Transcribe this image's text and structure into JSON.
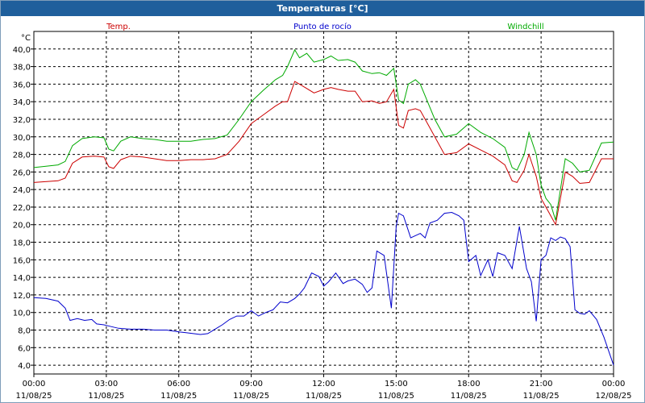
{
  "window": {
    "title": "Temperaturas [°C]"
  },
  "chart_data": {
    "type": "line",
    "title": "Temperaturas [°C]",
    "unit_label": "°C",
    "ylim": [
      3,
      42
    ],
    "ytick_values": [
      4,
      6,
      8,
      10,
      12,
      14,
      16,
      18,
      20,
      22,
      24,
      26,
      28,
      30,
      32,
      34,
      36,
      38,
      40
    ],
    "ytick_labels": [
      "4,0",
      "6,0",
      "8,0",
      "10,0",
      "12,0",
      "14,0",
      "16,0",
      "18,0",
      "20,0",
      "22,0",
      "24,0",
      "26,0",
      "28,0",
      "30,0",
      "32,0",
      "34,0",
      "36,0",
      "38,0",
      "40,0"
    ],
    "xlim": [
      0,
      24
    ],
    "xtick_values": [
      0,
      3,
      6,
      9,
      12,
      15,
      18,
      21,
      24
    ],
    "xtick_time": [
      "00:00",
      "03:00",
      "06:00",
      "09:00",
      "12:00",
      "15:00",
      "18:00",
      "21:00",
      "00:00"
    ],
    "xtick_date": [
      "11/08/25",
      "11/08/25",
      "11/08/25",
      "11/08/25",
      "11/08/25",
      "11/08/25",
      "11/08/25",
      "11/08/25",
      "12/08/25"
    ],
    "grid": true,
    "legend_placement": "top",
    "series": [
      {
        "name": "Temp.",
        "color": "#cc0000",
        "x": [
          0,
          1,
          1.3,
          1.6,
          2,
          2.5,
          2.9,
          3.1,
          3.3,
          3.6,
          4,
          4.5,
          5,
          5.5,
          6,
          6.5,
          7,
          7.5,
          8,
          8.5,
          9,
          9.5,
          10,
          10.3,
          10.5,
          10.8,
          11,
          11.3,
          11.6,
          12,
          12.3,
          12.6,
          13,
          13.3,
          13.6,
          14,
          14.3,
          14.6,
          14.9,
          15.1,
          15.3,
          15.5,
          15.8,
          16,
          16.3,
          16.6,
          17,
          17.5,
          18,
          18.5,
          19,
          19.5,
          19.8,
          20,
          20.3,
          20.5,
          20.8,
          21,
          21.2,
          21.4,
          21.6,
          22,
          22.3,
          22.6,
          23,
          23.5,
          24
        ],
        "y": [
          24.8,
          25,
          25.3,
          27,
          27.7,
          27.8,
          27.7,
          26.6,
          26.4,
          27.4,
          27.8,
          27.7,
          27.5,
          27.3,
          27.3,
          27.4,
          27.4,
          27.5,
          28,
          29.5,
          31.5,
          32.5,
          33.5,
          34,
          34,
          36.3,
          36,
          35.5,
          35,
          35.4,
          35.6,
          35.4,
          35.2,
          35.2,
          34,
          34.1,
          33.8,
          34,
          35.4,
          31.3,
          31,
          33,
          33.2,
          33,
          31.5,
          30,
          28,
          28.2,
          29.2,
          28.5,
          27.8,
          26.8,
          25,
          24.8,
          26.2,
          28,
          25.5,
          23,
          22,
          21,
          20,
          26,
          25.5,
          24.7,
          24.8,
          27.5,
          27.5
        ]
      },
      {
        "name": "Punto de rocío",
        "color": "#0000cc",
        "x": [
          0,
          0.5,
          1,
          1.3,
          1.5,
          1.8,
          2.1,
          2.4,
          2.6,
          2.9,
          3.2,
          3.5,
          4,
          4.5,
          5,
          5.5,
          6,
          6.3,
          6.6,
          6.9,
          7.2,
          7.5,
          7.8,
          8.1,
          8.4,
          8.7,
          9,
          9.3,
          9.6,
          9.9,
          10.2,
          10.5,
          10.8,
          11,
          11.2,
          11.5,
          11.8,
          12,
          12.2,
          12.5,
          12.8,
          13,
          13.3,
          13.6,
          13.8,
          14,
          14.2,
          14.5,
          14.8,
          15,
          15.1,
          15.3,
          15.6,
          16,
          16.2,
          16.4,
          16.7,
          17,
          17.3,
          17.6,
          17.8,
          18,
          18.3,
          18.5,
          18.8,
          19,
          19.2,
          19.5,
          19.8,
          20.1,
          20.4,
          20.6,
          20.8,
          21,
          21.2,
          21.4,
          21.6,
          21.8,
          22,
          22.2,
          22.4,
          22.6,
          22.8,
          23,
          23.3,
          23.6,
          24
        ],
        "y": [
          11.7,
          11.6,
          11.3,
          10.5,
          9.1,
          9.3,
          9.1,
          9.2,
          8.7,
          8.6,
          8.4,
          8.2,
          8.1,
          8.1,
          8,
          8,
          7.8,
          7.7,
          7.6,
          7.5,
          7.6,
          8.1,
          8.6,
          9.2,
          9.6,
          9.6,
          10.2,
          9.6,
          10,
          10.3,
          11.2,
          11.1,
          11.6,
          12.1,
          12.8,
          14.5,
          14.1,
          13,
          13.5,
          14.5,
          13.3,
          13.6,
          13.8,
          13.2,
          12.3,
          12.8,
          17,
          16.5,
          10.5,
          19.8,
          21.3,
          21,
          18.5,
          19,
          18.5,
          20.2,
          20.5,
          21.3,
          21.4,
          21,
          20.5,
          15.8,
          16.5,
          14.2,
          16,
          14.1,
          16.8,
          16.5,
          15,
          19.8,
          15,
          13.5,
          9,
          16,
          16.5,
          18.5,
          18.2,
          18.6,
          18.4,
          17.5,
          10.3,
          9.9,
          9.8,
          10.2,
          9.2,
          7.2,
          4.0
        ]
      },
      {
        "name": "Windchill",
        "color": "#00aa00",
        "x": [
          0,
          1,
          1.3,
          1.6,
          2,
          2.5,
          2.9,
          3.1,
          3.3,
          3.6,
          4,
          4.5,
          5,
          5.5,
          6,
          6.5,
          7,
          7.5,
          8,
          8.5,
          9,
          9.5,
          10,
          10.3,
          10.5,
          10.8,
          11,
          11.3,
          11.6,
          12,
          12.3,
          12.6,
          13,
          13.3,
          13.6,
          14,
          14.3,
          14.6,
          14.9,
          15.1,
          15.3,
          15.5,
          15.8,
          16,
          16.3,
          16.6,
          17,
          17.5,
          18,
          18.5,
          19,
          19.5,
          19.8,
          20,
          20.3,
          20.5,
          20.8,
          21,
          21.2,
          21.4,
          21.6,
          22,
          22.3,
          22.6,
          23,
          23.5,
          24
        ],
        "y": [
          26.5,
          26.8,
          27.2,
          29,
          29.8,
          30,
          29.9,
          28.6,
          28.4,
          29.5,
          30,
          29.8,
          29.7,
          29.5,
          29.5,
          29.5,
          29.7,
          29.8,
          30.2,
          32,
          34,
          35.3,
          36.5,
          37,
          38,
          39.9,
          39,
          39.5,
          38.5,
          38.8,
          39.2,
          38.7,
          38.8,
          38.5,
          37.5,
          37.2,
          37.3,
          37,
          37.8,
          34.2,
          33.8,
          36,
          36.5,
          36,
          34,
          32,
          30,
          30.3,
          31.5,
          30.5,
          29.8,
          28.8,
          26.5,
          26.2,
          28,
          30.5,
          28,
          24.5,
          23,
          22.3,
          20.5,
          27.5,
          27,
          26,
          26.2,
          29.3,
          29.4
        ]
      }
    ]
  }
}
